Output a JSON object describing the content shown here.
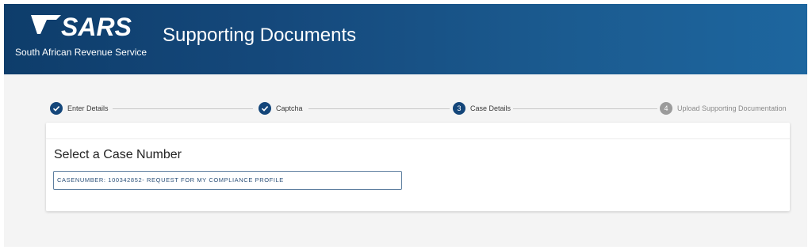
{
  "header": {
    "logo_text": "SARS",
    "logo_subtitle": "South African Revenue Service",
    "title": "Supporting Documents"
  },
  "stepper": {
    "steps": [
      {
        "label": "Enter Details",
        "state": "complete",
        "icon": "check-icon"
      },
      {
        "label": "Captcha",
        "state": "complete",
        "icon": "check-icon"
      },
      {
        "label": "Case Details",
        "state": "active",
        "number": "3"
      },
      {
        "label": "Upload Supporting Documentation",
        "state": "pending",
        "number": "4"
      }
    ]
  },
  "case_card": {
    "title": "Select a Case Number",
    "selected_case": "CASENUMBER: 100342852- REQUEST FOR MY COMPLIANCE PROFILE"
  },
  "colors": {
    "header_dark": "#0e3d6b",
    "header_light": "#1d669f",
    "step_active": "#14467a",
    "step_pending": "#9b9b9b",
    "field_border": "#5e7fa0"
  }
}
